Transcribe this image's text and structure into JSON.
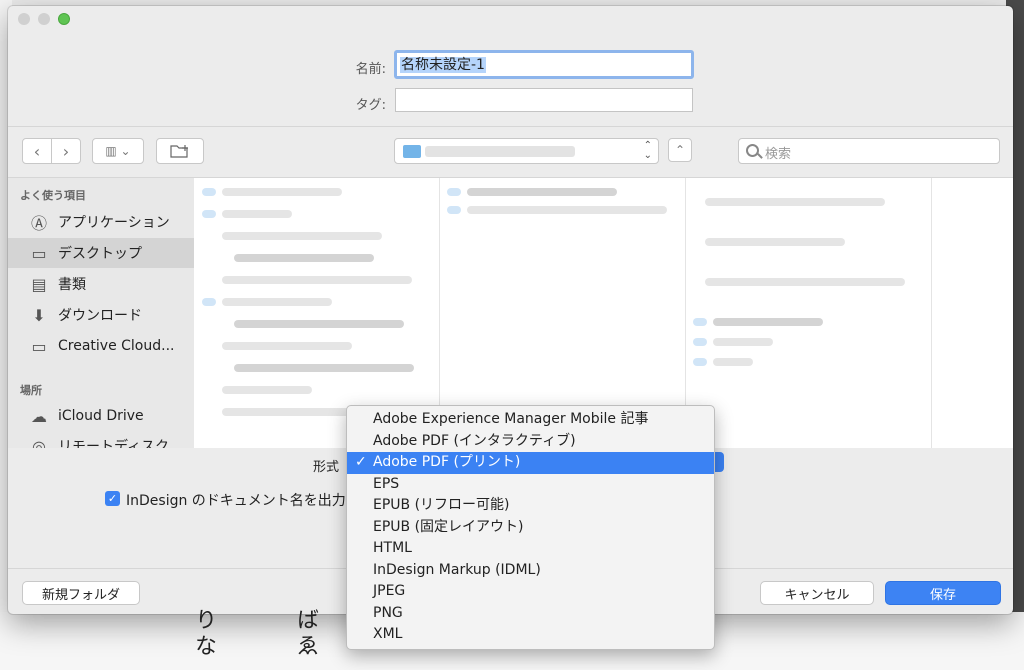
{
  "dialog": {
    "name_label": "名前:",
    "name_value": "名称未設定-1",
    "tag_label": "タグ:",
    "tag_value": ""
  },
  "toolbar": {
    "back_icon": "chevron-left-icon",
    "forward_icon": "chevron-right-icon",
    "view_icon": "column-view-icon",
    "new_folder_icon": "new-folder-icon",
    "search_placeholder": "検索"
  },
  "sidebar": {
    "favorites_header": "よく使う項目",
    "favorites": [
      {
        "label": "アプリケーション",
        "icon": "applications-icon"
      },
      {
        "label": "デスクトップ",
        "icon": "desktop-icon"
      },
      {
        "label": "書類",
        "icon": "documents-icon"
      },
      {
        "label": "ダウンロード",
        "icon": "downloads-icon"
      },
      {
        "label": "Creative Cloud...",
        "icon": "folder-icon"
      }
    ],
    "locations_header": "場所",
    "locations": [
      {
        "label": "iCloud Drive",
        "icon": "cloud-icon"
      },
      {
        "label": "リモートディスク",
        "icon": "disc-icon"
      }
    ]
  },
  "options": {
    "format_label": "形式",
    "checkbox_label": "InDesign のドキュメント名を出力",
    "checkbox_checked": true
  },
  "format_menu": {
    "items": [
      "Adobe Experience Manager Mobile 記事",
      "Adobe PDF (インタラクティブ)",
      "Adobe PDF (プリント)",
      "EPS",
      "EPUB (リフロー可能)",
      "EPUB (固定レイアウト)",
      "HTML",
      "InDesign Markup (IDML)",
      "JPEG",
      "PNG",
      "XML"
    ],
    "selected_index": 2,
    "check_mark": "✓"
  },
  "footer": {
    "new_folder_label": "新規フォルダ",
    "cancel_label": "キャンセル",
    "save_label": "保存"
  },
  "colors": {
    "accent": "#3b82f3",
    "selection": "#b5d4fb"
  }
}
